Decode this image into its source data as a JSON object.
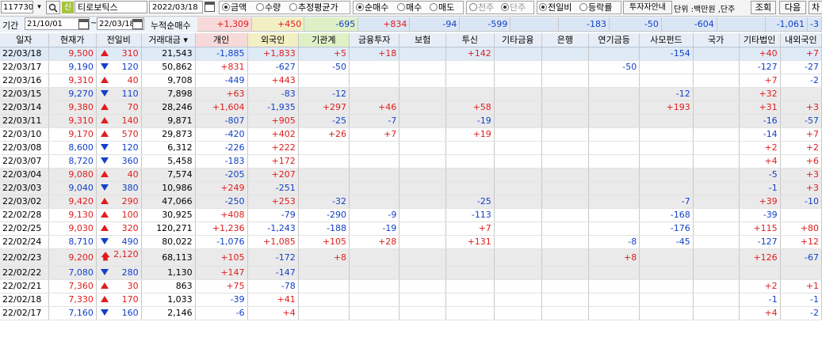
{
  "toolbar": {
    "stock_code": "117730",
    "stock_badge": "신",
    "stock_name": "티로보틱스",
    "date": "2022/03/18",
    "amount_radios": [
      "금액",
      "수량",
      "추정평균가"
    ],
    "amount_selected": 0,
    "buy_radios": [
      "순매수",
      "매수",
      "매도"
    ],
    "buy_selected": 0,
    "unit_radios": [
      "천주",
      "단주"
    ],
    "unit_selected": 1,
    "compare_radios": [
      "전일비",
      "등락률"
    ],
    "compare_selected": 0,
    "guide_button": "투자자안내",
    "unit_label": "단위 :백만원 ,단주",
    "query_button": "조회",
    "next_button": "다음",
    "chart_button": "차"
  },
  "period": {
    "label": "기간",
    "from": "21/10/01",
    "to": "22/03/18",
    "cumulative_label": "누적순매수",
    "values": [
      "+1,309",
      "+450",
      "-695",
      "+834",
      "-94",
      "-599",
      "",
      "-183",
      "-50",
      "-604",
      "",
      "-1,061",
      "-3"
    ]
  },
  "colors": {
    "up": "#e01c1c",
    "down": "#1240c8",
    "header_bg": "#e7edf6",
    "selected_row": "#dfeaf7"
  },
  "columns": [
    "일자",
    "현재가",
    "전일비",
    "거래대금",
    "개인",
    "외국인",
    "기관계",
    "금융투자",
    "보험",
    "투신",
    "기타금융",
    "은행",
    "연기금등",
    "사모펀드",
    "국가",
    "기타법인",
    "내외국인"
  ],
  "rows": [
    {
      "date": "22/03/18",
      "price": "9,500",
      "dir": "up",
      "change": "310",
      "volume": "21,543",
      "vals": [
        "-1,885",
        "+1,833",
        "+5",
        "+18",
        "",
        "+142",
        "",
        "",
        "",
        "-154",
        "",
        "+40",
        "+7"
      ]
    },
    {
      "date": "22/03/17",
      "price": "9,190",
      "dir": "dn",
      "change": "120",
      "volume": "50,862",
      "vals": [
        "+831",
        "-627",
        "-50",
        "",
        "",
        "",
        "",
        "",
        "-50",
        "",
        "",
        "-127",
        "-27"
      ]
    },
    {
      "date": "22/03/16",
      "price": "9,310",
      "dir": "up",
      "change": "40",
      "volume": "9,708",
      "vals": [
        "-449",
        "+443",
        "",
        "",
        "",
        "",
        "",
        "",
        "",
        "",
        "",
        "+7",
        "-2"
      ]
    },
    {
      "date": "22/03/15",
      "price": "9,270",
      "dir": "dn",
      "change": "110",
      "volume": "7,898",
      "vals": [
        "+63",
        "-83",
        "-12",
        "",
        "",
        "",
        "",
        "",
        "",
        "-12",
        "",
        "+32",
        ""
      ]
    },
    {
      "date": "22/03/14",
      "price": "9,380",
      "dir": "up",
      "change": "70",
      "volume": "28,246",
      "vals": [
        "+1,604",
        "-1,935",
        "+297",
        "+46",
        "",
        "+58",
        "",
        "",
        "",
        "+193",
        "",
        "+31",
        "+3"
      ]
    },
    {
      "date": "22/03/11",
      "price": "9,310",
      "dir": "up",
      "change": "140",
      "volume": "9,871",
      "vals": [
        "-807",
        "+905",
        "-25",
        "-7",
        "",
        "-19",
        "",
        "",
        "",
        "",
        "",
        "-16",
        "-57"
      ]
    },
    {
      "date": "22/03/10",
      "price": "9,170",
      "dir": "up",
      "change": "570",
      "volume": "29,873",
      "vals": [
        "-420",
        "+402",
        "+26",
        "+7",
        "",
        "+19",
        "",
        "",
        "",
        "",
        "",
        "-14",
        "+7"
      ]
    },
    {
      "date": "22/03/08",
      "price": "8,600",
      "dir": "dn",
      "change": "120",
      "volume": "6,312",
      "vals": [
        "-226",
        "+222",
        "",
        "",
        "",
        "",
        "",
        "",
        "",
        "",
        "",
        "+2",
        "+2"
      ]
    },
    {
      "date": "22/03/07",
      "price": "8,720",
      "dir": "dn",
      "change": "360",
      "volume": "5,458",
      "vals": [
        "-183",
        "+172",
        "",
        "",
        "",
        "",
        "",
        "",
        "",
        "",
        "",
        "+4",
        "+6"
      ]
    },
    {
      "date": "22/03/04",
      "price": "9,080",
      "dir": "up",
      "change": "40",
      "volume": "7,574",
      "vals": [
        "-205",
        "+207",
        "",
        "",
        "",
        "",
        "",
        "",
        "",
        "",
        "",
        "-5",
        "+3"
      ]
    },
    {
      "date": "22/03/03",
      "price": "9,040",
      "dir": "dn",
      "change": "380",
      "volume": "10,986",
      "vals": [
        "+249",
        "-251",
        "",
        "",
        "",
        "",
        "",
        "",
        "",
        "",
        "",
        "-1",
        "+3"
      ]
    },
    {
      "date": "22/03/02",
      "price": "9,420",
      "dir": "up",
      "change": "290",
      "volume": "47,066",
      "vals": [
        "-250",
        "+253",
        "-32",
        "",
        "",
        "-25",
        "",
        "",
        "",
        "-7",
        "",
        "+39",
        "-10"
      ]
    },
    {
      "date": "22/02/28",
      "price": "9,130",
      "dir": "up",
      "change": "100",
      "volume": "30,925",
      "vals": [
        "+408",
        "-79",
        "-290",
        "-9",
        "",
        "-113",
        "",
        "",
        "",
        "-168",
        "",
        "-39",
        ""
      ]
    },
    {
      "date": "22/02/25",
      "price": "9,030",
      "dir": "up",
      "change": "320",
      "volume": "120,271",
      "vals": [
        "+1,236",
        "-1,243",
        "-188",
        "-19",
        "",
        "+7",
        "",
        "",
        "",
        "-176",
        "",
        "+115",
        "+80"
      ]
    },
    {
      "date": "22/02/24",
      "price": "8,710",
      "dir": "dn",
      "change": "490",
      "volume": "80,022",
      "vals": [
        "-1,076",
        "+1,085",
        "+105",
        "+28",
        "",
        "+131",
        "",
        "",
        "-8",
        "-45",
        "",
        "-127",
        "+12"
      ]
    },
    {
      "date": "22/02/23",
      "price": "9,200",
      "dir": "upbig",
      "change": "2,120",
      "volume": "68,113",
      "vals": [
        "+105",
        "-172",
        "+8",
        "",
        "",
        "",
        "",
        "",
        "+8",
        "",
        "",
        "+126",
        "-67"
      ]
    },
    {
      "date": "22/02/22",
      "price": "7,080",
      "dir": "dn",
      "change": "280",
      "volume": "1,130",
      "vals": [
        "+147",
        "-147",
        "",
        "",
        "",
        "",
        "",
        "",
        "",
        "",
        "",
        "",
        ""
      ]
    },
    {
      "date": "22/02/21",
      "price": "7,360",
      "dir": "up",
      "change": "30",
      "volume": "863",
      "vals": [
        "+75",
        "-78",
        "",
        "",
        "",
        "",
        "",
        "",
        "",
        "",
        "",
        "+2",
        "+1"
      ]
    },
    {
      "date": "22/02/18",
      "price": "7,330",
      "dir": "up",
      "change": "170",
      "volume": "1,033",
      "vals": [
        "-39",
        "+41",
        "",
        "",
        "",
        "",
        "",
        "",
        "",
        "",
        "",
        "-1",
        "-1"
      ]
    },
    {
      "date": "22/02/17",
      "price": "7,160",
      "dir": "dn",
      "change": "160",
      "volume": "2,146",
      "vals": [
        "-6",
        "+4",
        "",
        "",
        "",
        "",
        "",
        "",
        "",
        "",
        "",
        "+4",
        "-2"
      ]
    }
  ]
}
